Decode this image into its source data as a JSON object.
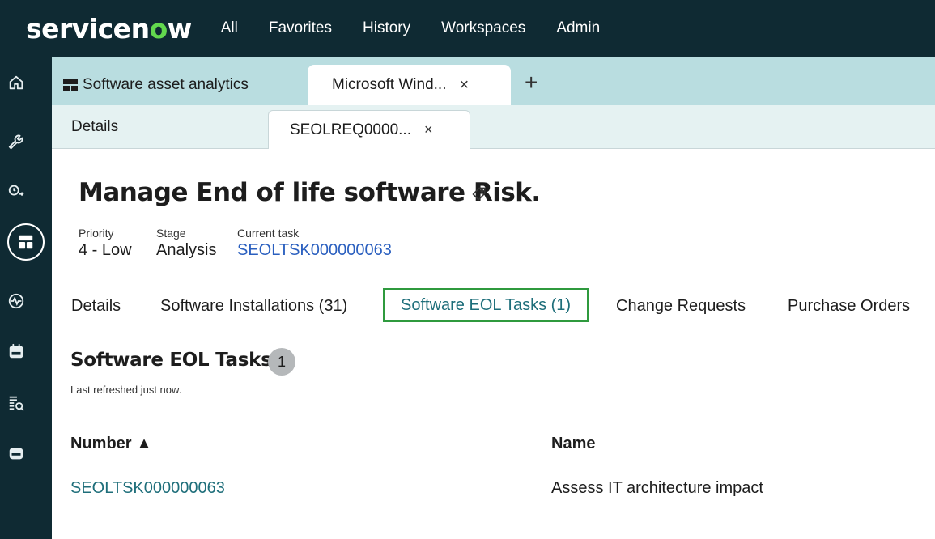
{
  "header": {
    "logo_pre": "servicen",
    "logo_o": "o",
    "logo_post": "w",
    "nav": [
      "All",
      "Favorites",
      "History",
      "Workspaces",
      "Admin"
    ]
  },
  "rail": {
    "icons": [
      "home-icon",
      "wrench-icon",
      "time-forward-icon",
      "workspace-icon",
      "activity-icon",
      "calendar-icon",
      "search-list-icon",
      "inbox-icon"
    ]
  },
  "workspace_tabs": [
    {
      "label": "Software asset analytics"
    },
    {
      "label": "Microsoft Wind...",
      "close": "×"
    }
  ],
  "workspace_tabs_add": "+",
  "sub_tabs": [
    {
      "label": "Details"
    },
    {
      "label": "SEOLREQ0000...",
      "close": "×"
    }
  ],
  "record": {
    "title": "Manage End of life software Risk.",
    "fields": [
      {
        "label": "Priority",
        "value": "4 - Low"
      },
      {
        "label": "Stage",
        "value": "Analysis"
      },
      {
        "label": "Current task",
        "value": "SEOLTSK000000063"
      }
    ],
    "tabs": [
      "Details",
      "Software Installations (31)",
      "Software EOL Tasks (1)",
      "Change Requests",
      "Purchase Orders"
    ]
  },
  "related_list": {
    "title": "Software EOL Tasks",
    "count": "1",
    "subtitle": "Last refreshed just now.",
    "columns": [
      "Number ▲",
      "Name"
    ],
    "rows": [
      [
        "SEOLTSK000000063",
        "Assess IT architecture impact"
      ]
    ]
  },
  "colors": {
    "header_bg": "#0f2a33",
    "logo_accent": "#62d84e",
    "tab_bar_bg": "#b9dde0",
    "active_tab_border": "#2f9a3e",
    "link": "#1e6e7a"
  }
}
